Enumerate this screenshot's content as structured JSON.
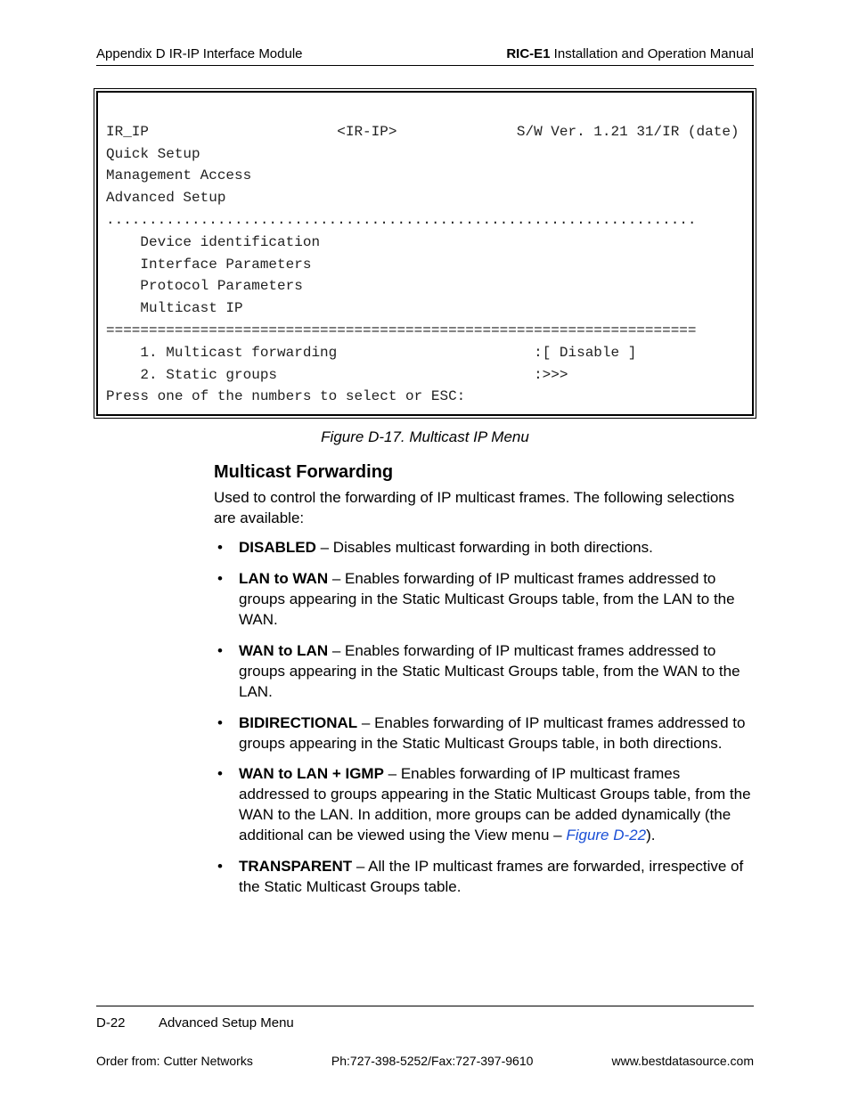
{
  "header": {
    "left": "Appendix D  IR-IP Interface Module",
    "right_bold": "RIC-E1",
    "right_rest": " Installation and Operation Manual"
  },
  "terminal": {
    "row1_left": "IR_IP",
    "row1_mid": "<IR-IP>",
    "row1_right": "S/W Ver. 1.21 31/IR (date)",
    "quick": "Quick Setup",
    "mgmt": "Management Access",
    "adv": "Advanced Setup",
    "dots": ".....................................................................",
    "devid": "    Device identification",
    "ifparam": "    Interface Parameters",
    "proto": "    Protocol Parameters",
    "mcast": "    Multicast IP",
    "eqline": "=====================================================================",
    "opt1_label": "    1. Multicast forwarding",
    "opt1_value": ":[ Disable ]",
    "opt2_label": "    2. Static groups",
    "opt2_value": ":>>>",
    "prompt": "Press one of the numbers to select or ESC:"
  },
  "figcaption": "Figure D-17.  Multicast IP Menu",
  "section_title": "Multicast Forwarding",
  "intro": "Used to control the forwarding of IP multicast frames. The following selections are available:",
  "bullets": [
    {
      "bold": "DISABLED",
      "text": " – Disables multicast forwarding in both directions."
    },
    {
      "bold": "LAN to WAN",
      "text": " – Enables forwarding of IP multicast frames addressed to groups appearing in the Static Multicast Groups table, from the LAN to the WAN."
    },
    {
      "bold": "WAN to LAN",
      "text": " – Enables forwarding of IP multicast frames addressed to groups appearing in the Static Multicast Groups table, from the WAN to the LAN."
    },
    {
      "bold": "BIDIRECTIONAL",
      "text": " – Enables forwarding of IP multicast frames addressed to groups appearing in the Static Multicast Groups table, in both directions."
    },
    {
      "bold": "WAN to LAN + IGMP",
      "text": " – Enables forwarding of IP multicast frames addressed to groups appearing in the Static Multicast Groups table, from the WAN to the LAN. In addition, more groups can be added dynamically (the additional can be viewed using the View menu – ",
      "link": "Figure D-22",
      "after_link": ")."
    },
    {
      "bold": "TRANSPARENT",
      "text": " – All the IP multicast frames are forwarded, irrespective of the Static Multicast Groups table."
    }
  ],
  "footer": {
    "page": "D-22",
    "section": "Advanced Setup Menu",
    "order": "Order from: Cutter Networks",
    "phone": "Ph:727-398-5252/Fax:727-397-9610",
    "url": "www.bestdatasource.com"
  }
}
